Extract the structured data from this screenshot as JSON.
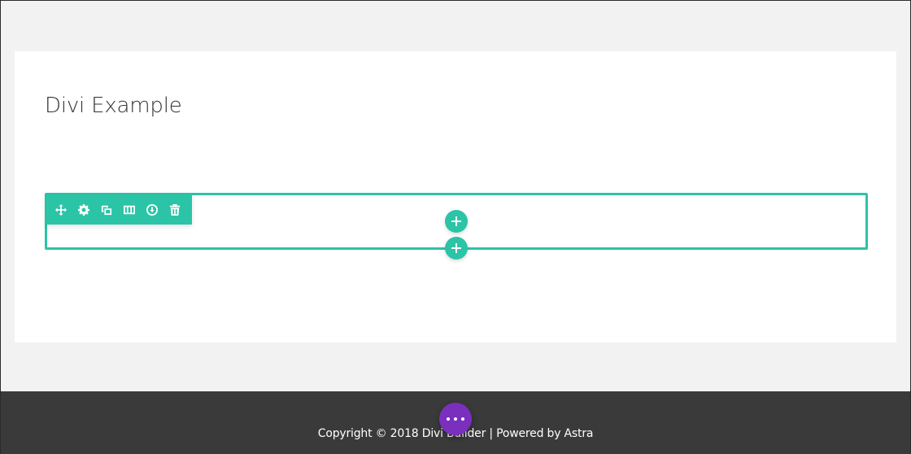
{
  "page": {
    "title": "Divi Example"
  },
  "section_toolbar": {
    "icons": [
      "move-icon",
      "gear-icon",
      "duplicate-icon",
      "columns-icon",
      "save-icon",
      "trash-icon"
    ]
  },
  "footer": {
    "copyright": "Copyright © 2018 Divi Builder | Powered by Astra"
  },
  "colors": {
    "accent": "#2bc4a6",
    "builder_menu": "#7b2fbd",
    "footer_bg": "#3a3a3a",
    "page_bg": "#f2f2f2"
  }
}
